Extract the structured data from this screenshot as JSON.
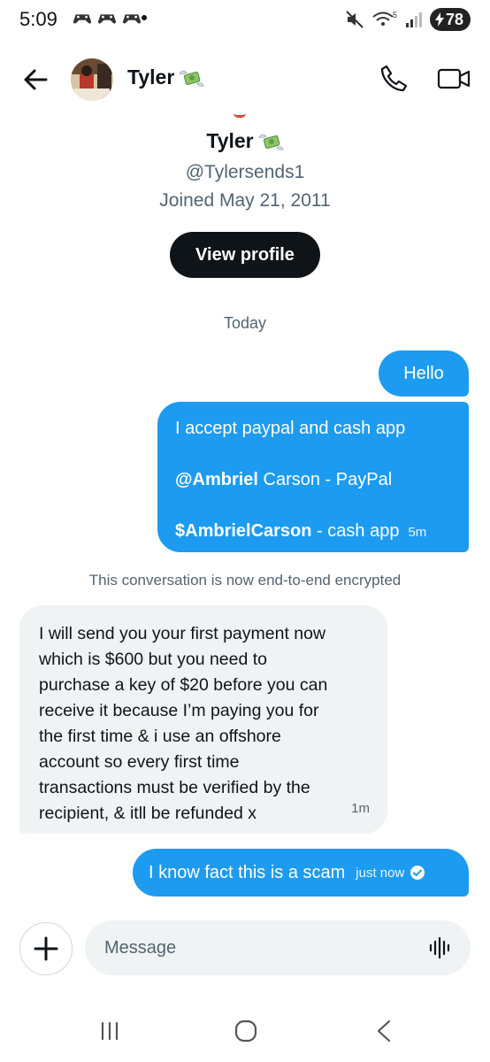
{
  "status_bar": {
    "time": "5:09",
    "battery": "78",
    "wifi_badge": "5"
  },
  "header": {
    "name": "Tyler",
    "emoji": "money-with-wings"
  },
  "profile": {
    "name": "Tyler",
    "handle": "@Tylersends1",
    "joined": "Joined May 21, 2011",
    "view_profile_label": "View profile"
  },
  "conversation": {
    "date_separator": "Today",
    "encryption_notice": "This conversation is now end-to-end encrypted",
    "messages": [
      {
        "direction": "outgoing",
        "text": "Hello"
      },
      {
        "direction": "outgoing",
        "line1": "I accept paypal and cash app",
        "line2_bold": "@Ambriel",
        "line2_rest": " Carson - PayPal",
        "line3_bold": "$AmbrielCarson",
        "line3_rest": " - cash app",
        "time": "5m"
      },
      {
        "direction": "incoming",
        "lines": [
          "I will send you your first payment now",
          "which is $600 but you need to",
          "purchase a key of $20 before you can",
          "receive it because I’m paying you for",
          "the first time & i use an offshore",
          "account so every first time",
          "transactions must be verified by the",
          "recipient, & itll be refunded x"
        ],
        "time": "1m"
      },
      {
        "direction": "outgoing",
        "text": "I know fact this is a scam",
        "time": "just now",
        "status": "read"
      }
    ]
  },
  "composer": {
    "placeholder": "Message"
  },
  "colors": {
    "accent": "#1d9bf0",
    "incoming_bubble": "#eff3f4",
    "text_secondary": "#536471"
  }
}
